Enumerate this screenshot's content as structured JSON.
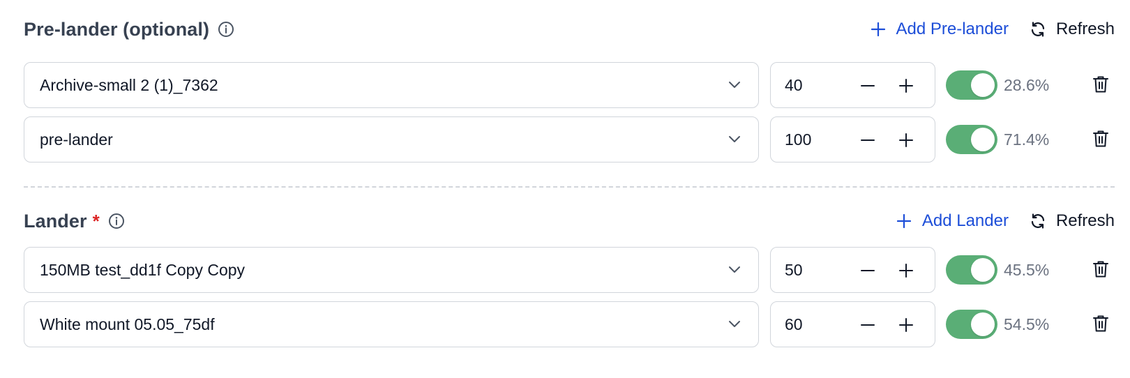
{
  "prelander": {
    "title": "Pre-lander (optional)",
    "add_label": "Add Pre-lander",
    "refresh_label": "Refresh",
    "rows": [
      {
        "name": "Archive-small 2 (1)_7362",
        "weight": "40",
        "enabled": true,
        "percent": "28.6%"
      },
      {
        "name": "pre-lander",
        "weight": "100",
        "enabled": true,
        "percent": "71.4%"
      }
    ]
  },
  "lander": {
    "title": "Lander",
    "required_mark": "*",
    "add_label": "Add Lander",
    "refresh_label": "Refresh",
    "rows": [
      {
        "name": "150MB test_dd1f Copy Copy",
        "weight": "50",
        "enabled": true,
        "percent": "45.5%"
      },
      {
        "name": "White mount 05.05_75df",
        "weight": "60",
        "enabled": true,
        "percent": "54.5%"
      }
    ]
  },
  "colors": {
    "accent": "#1d4ed8",
    "toggle_on": "#5aae76",
    "required": "#dc2626",
    "border": "#d1d5db"
  },
  "icons": [
    "info-icon",
    "plus-icon",
    "refresh-icon",
    "chevron-down-icon",
    "minus-icon",
    "trash-icon"
  ]
}
